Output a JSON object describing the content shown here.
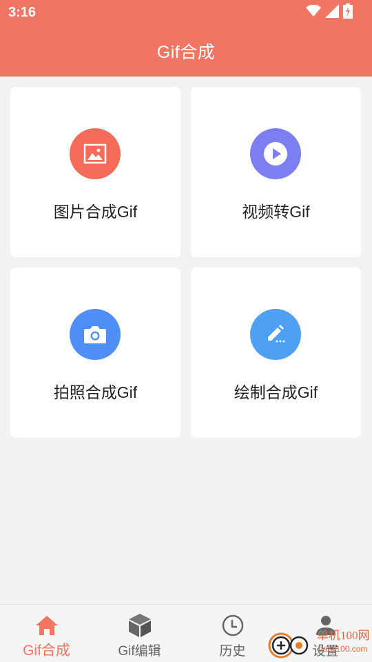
{
  "status_bar": {
    "time": "3:16"
  },
  "header": {
    "title": "Gif合成"
  },
  "cards": [
    {
      "label": "图片合成Gif",
      "icon": "image-icon",
      "color": "#f56b5a"
    },
    {
      "label": "视频转Gif",
      "icon": "play-icon",
      "color": "#7b7ff2"
    },
    {
      "label": "拍照合成Gif",
      "icon": "camera-icon",
      "color": "#4e8ef7"
    },
    {
      "label": "绘制合成Gif",
      "icon": "pencil-icon",
      "color": "#4ea0f2"
    }
  ],
  "bottom_nav": {
    "items": [
      {
        "label": "Gif合成",
        "icon": "home-icon",
        "active": true
      },
      {
        "label": "Gif编辑",
        "icon": "cube-icon",
        "active": false
      },
      {
        "label": "历史",
        "icon": "clock-icon",
        "active": false
      },
      {
        "label": "设置",
        "icon": "person-icon",
        "active": false
      }
    ]
  },
  "watermark": {
    "text": "单机100网",
    "url": "danji100.com"
  },
  "colors": {
    "accent": "#f07562",
    "background": "#f2f2f2",
    "inactive": "#666666"
  }
}
